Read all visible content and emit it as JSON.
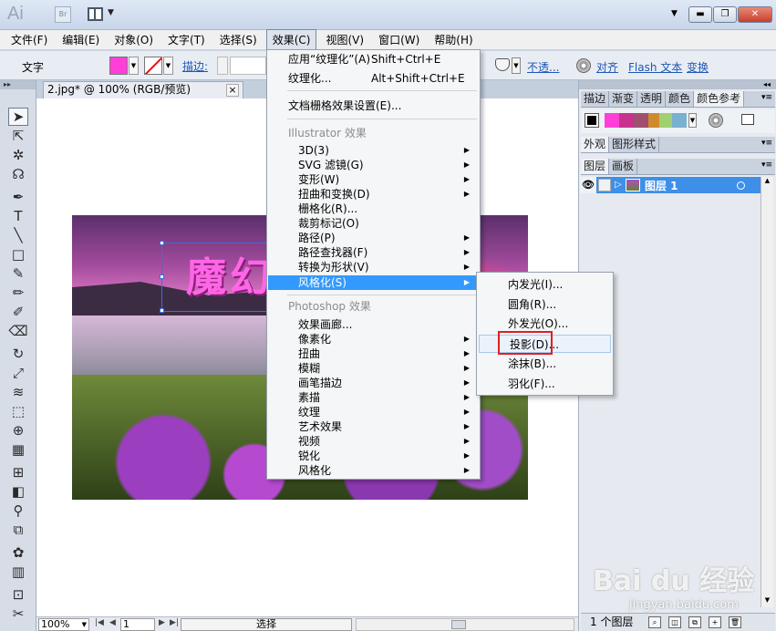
{
  "titlebar": {
    "app_logo": "Ai",
    "bridge_label": "Br",
    "window_controls": {
      "minimize": "▬",
      "restore": "❐",
      "close": "✕"
    }
  },
  "menubar": {
    "items": [
      "文件(F)",
      "编辑(E)",
      "对象(O)",
      "文字(T)",
      "选择(S)",
      "效果(C)",
      "视图(V)",
      "窗口(W)",
      "帮助(H)"
    ],
    "active_index": 5
  },
  "controlbar": {
    "type_label": "文字",
    "stroke_label": "描边:",
    "opacity_label": "不透...",
    "align_label": "对齐",
    "flash_label": "Flash 文本",
    "transform_label": "变换",
    "fill_color": "#ff3fd8"
  },
  "document": {
    "tab_title": "2.jpg* @ 100% (RGB/预览)",
    "art_text": "魔幻"
  },
  "statusbar": {
    "zoom": "100%",
    "page": "1",
    "status": "选择"
  },
  "effect_menu": {
    "apply_last": "应用“纹理化”(A)",
    "apply_last_shortcut": "Shift+Ctrl+E",
    "last_effect": "纹理化...",
    "last_effect_shortcut": "Alt+Shift+Ctrl+E",
    "raster_settings": "文档栅格效果设置(E)...",
    "illustrator_header": "Illustrator 效果",
    "illustrator_items": [
      "3D(3)",
      "SVG 滤镜(G)",
      "变形(W)",
      "扭曲和变换(D)",
      "栅格化(R)...",
      "裁剪标记(O)",
      "路径(P)",
      "路径查找器(F)",
      "转换为形状(V)",
      "风格化(S)"
    ],
    "photoshop_header": "Photoshop 效果",
    "photoshop_items": [
      "效果画廊...",
      "像素化",
      "扭曲",
      "模糊",
      "画笔描边",
      "素描",
      "纹理",
      "艺术效果",
      "视频",
      "锐化",
      "风格化"
    ]
  },
  "stylize_submenu": {
    "items": [
      "内发光(I)...",
      "圆角(R)...",
      "外发光(O)...",
      "投影(D)...",
      "涂抹(B)...",
      "羽化(F)..."
    ],
    "hover_index": 3
  },
  "right_panel": {
    "top_tabs": [
      "描边",
      "渐变",
      "透明",
      "颜色",
      "颜色参考"
    ],
    "guide_swatches": [
      "#ff3fd8",
      "#c8328e",
      "#a0506e",
      "#d08a2e",
      "#a0d070",
      "#7ab0d0"
    ],
    "style_tabs": [
      "外观",
      "图形样式"
    ],
    "layer_tabs": [
      "图层",
      "画板"
    ],
    "layer_name": "图层 1",
    "layer_count": "1 个图层"
  },
  "watermark": {
    "logo_text": "Bai du 经验",
    "url": "jingyan.baidu.com"
  }
}
